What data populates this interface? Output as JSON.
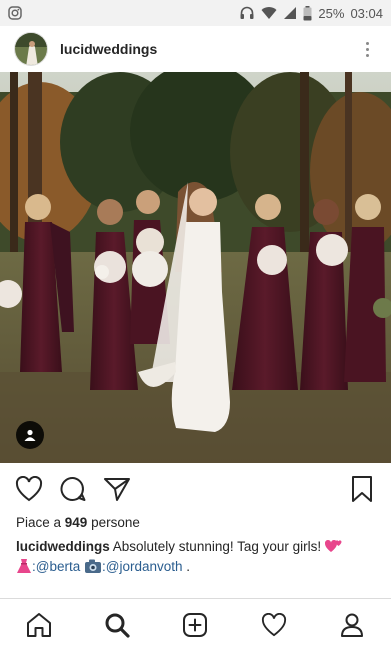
{
  "status_bar": {
    "battery": "25%",
    "time": "03:04",
    "icons": [
      "instagram-notification-icon",
      "headphones-icon",
      "wifi-icon",
      "signal-icon",
      "battery-icon"
    ]
  },
  "post": {
    "username": "lucidweddings",
    "likes_prefix": "Piace a ",
    "likes_count": "949",
    "likes_suffix": " persone",
    "caption_user": "lucidweddings",
    "caption_text": " Absolutely stunning! Tag your girls!",
    "mention_1": ":@berta",
    "mention_2": ":@jordanvoth",
    "caption_end": " ."
  },
  "icons": {
    "more": "more-options-icon",
    "like": "heart-icon",
    "comment": "comment-icon",
    "share": "send-icon",
    "save": "bookmark-icon",
    "tag": "user-tag-icon",
    "nav": [
      "home-icon",
      "search-icon",
      "add-post-icon",
      "activity-heart-icon",
      "profile-icon"
    ]
  },
  "colors": {
    "accent_text": "#262626",
    "mention": "#2a5d8f",
    "dress": "#4a1422"
  }
}
